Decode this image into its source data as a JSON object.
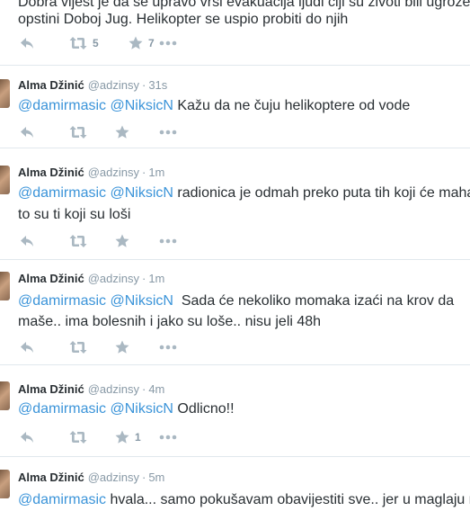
{
  "icons": {
    "reply": "reply-icon",
    "retweet": "retweet-icon",
    "favorite": "star-icon",
    "more": "more-icon"
  },
  "colors": {
    "mention": "#3b94d9",
    "meta": "#8899a6",
    "text": "#292f33",
    "icon": "#aab8c2"
  },
  "top_tweet": {
    "line1": "Dobra vijest je da se upravo vrši evakuacija ljudi čiji su životi bili ugroženi",
    "line2": "opstini Doboj Jug. Helikopter se uspio probiti do njih",
    "retweets": "5",
    "favorites": "7"
  },
  "tweets": [
    {
      "name": "Alma Džinić",
      "handle": "@adzinsy",
      "time": "31s",
      "m1": "@damirmasic",
      "m2": "@NiksicN",
      "body": " Kažu da ne čuju helikoptere od vode",
      "line2": "",
      "favorites": ""
    },
    {
      "name": "Alma Džinić",
      "handle": "@adzinsy",
      "time": "1m",
      "m1": "@damirmasic",
      "m2": "@NiksicN",
      "body": " radionica je odmah preko puta tih koji će mahat",
      "line2": "to su ti koji su loši",
      "favorites": ""
    },
    {
      "name": "Alma Džinić",
      "handle": "@adzinsy",
      "time": "1m",
      "m1": "@damirmasic",
      "m2": "@NiksicN",
      "body": "  Sada će nekoliko momaka izaći na krov da",
      "line2": "maše.. ima bolesnih i jako su loše.. nisu jeli 48h",
      "favorites": ""
    },
    {
      "name": "Alma Džinić",
      "handle": "@adzinsy",
      "time": "4m",
      "m1": "@damirmasic",
      "m2": "@NiksicN",
      "body": " Odlicno!!",
      "line2": "",
      "favorites": "1"
    },
    {
      "name": "Alma Džinić",
      "handle": "@adzinsy",
      "time": "5m",
      "m1": "@damirmasic",
      "m2": "",
      "body": " hvala... samo pokušavam obavijestiti sve.. jer u maglaju ne",
      "line2": "",
      "favorites": ""
    }
  ]
}
